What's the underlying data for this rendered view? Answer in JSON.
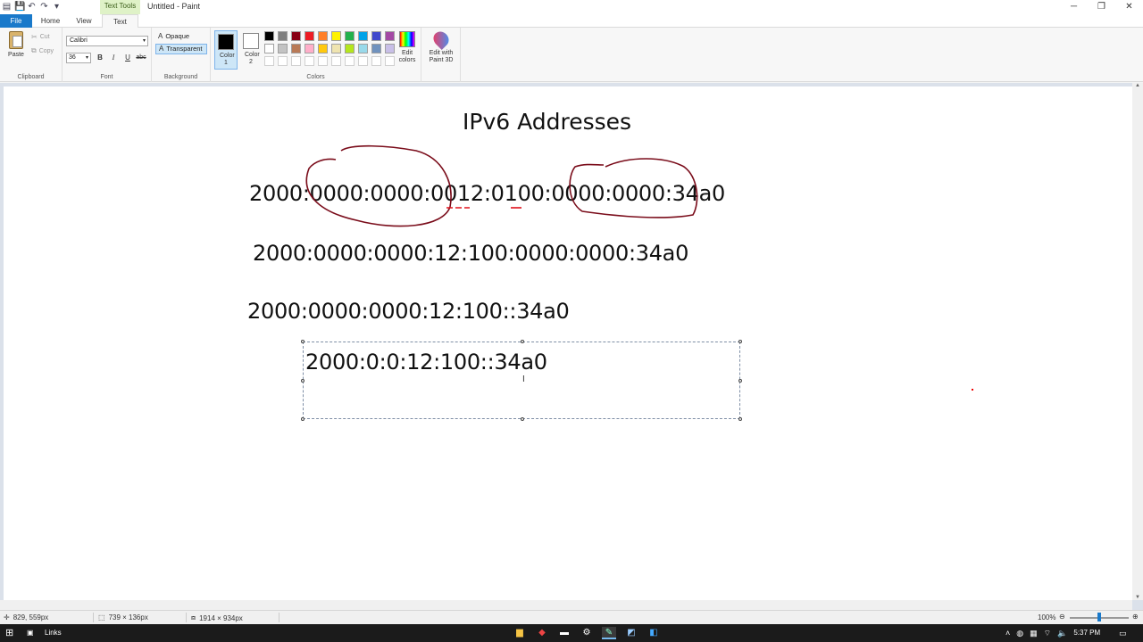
{
  "window": {
    "title": "Untitled - Paint",
    "context_tab": "Text Tools",
    "controls": [
      "─",
      "❐",
      "✕"
    ]
  },
  "tabs": [
    {
      "label": "File"
    },
    {
      "label": "Home"
    },
    {
      "label": "View"
    },
    {
      "label": "Text"
    }
  ],
  "ribbon": {
    "clipboard": {
      "paste": "Paste",
      "cut": "Cut",
      "copy": "Copy",
      "label": "Clipboard"
    },
    "font": {
      "family": "Calibri",
      "size": "36",
      "bold": "B",
      "italic": "I",
      "underline": "U",
      "strike": "abc",
      "label": "Font"
    },
    "background": {
      "opaque": "Opaque",
      "transparent": "Transparent",
      "label": "Background"
    },
    "colors": {
      "color1": "Color 1",
      "color2": "Color 2",
      "color1_value": "#000000",
      "color2_value": "#ffffff",
      "edit": "Edit colors",
      "label": "Colors",
      "palette": [
        "#000000",
        "#7f7f7f",
        "#880015",
        "#ed1c24",
        "#ff7f27",
        "#fff200",
        "#22b14c",
        "#00a2e8",
        "#3f48cc",
        "#a349a4",
        "#ffffff",
        "#c3c3c3",
        "#b97a57",
        "#ffaec9",
        "#ffc90e",
        "#efe4b0",
        "#b5e61d",
        "#99d9ea",
        "#7092be",
        "#c8bfe7",
        "#ffffff",
        "#ffffff",
        "#ffffff",
        "#ffffff",
        "#ffffff",
        "#ffffff",
        "#ffffff",
        "#ffffff",
        "#ffffff",
        "#ffffff"
      ]
    },
    "paint3d": {
      "label": "Edit with Paint 3D"
    }
  },
  "canvas": {
    "title": "IPv6 Addresses",
    "line1": "2000:0000:0000:0012:0100:0000:0000:34a0",
    "line2": "2000:0000:0000:12:100:0000:0000:34a0",
    "line3": "2000:0000:0000:12:100::34a0",
    "line4": "2000:0:0:12:100::34a0",
    "ink_color": "#7a0c1a",
    "accent_red": "#e0101a"
  },
  "status": {
    "cursor": "829, 559px",
    "selection": "739 × 136px",
    "canvas_size": "1914 × 934px",
    "zoom": "100%"
  },
  "taskbar": {
    "links": "Links",
    "time": "5:37 PM"
  }
}
